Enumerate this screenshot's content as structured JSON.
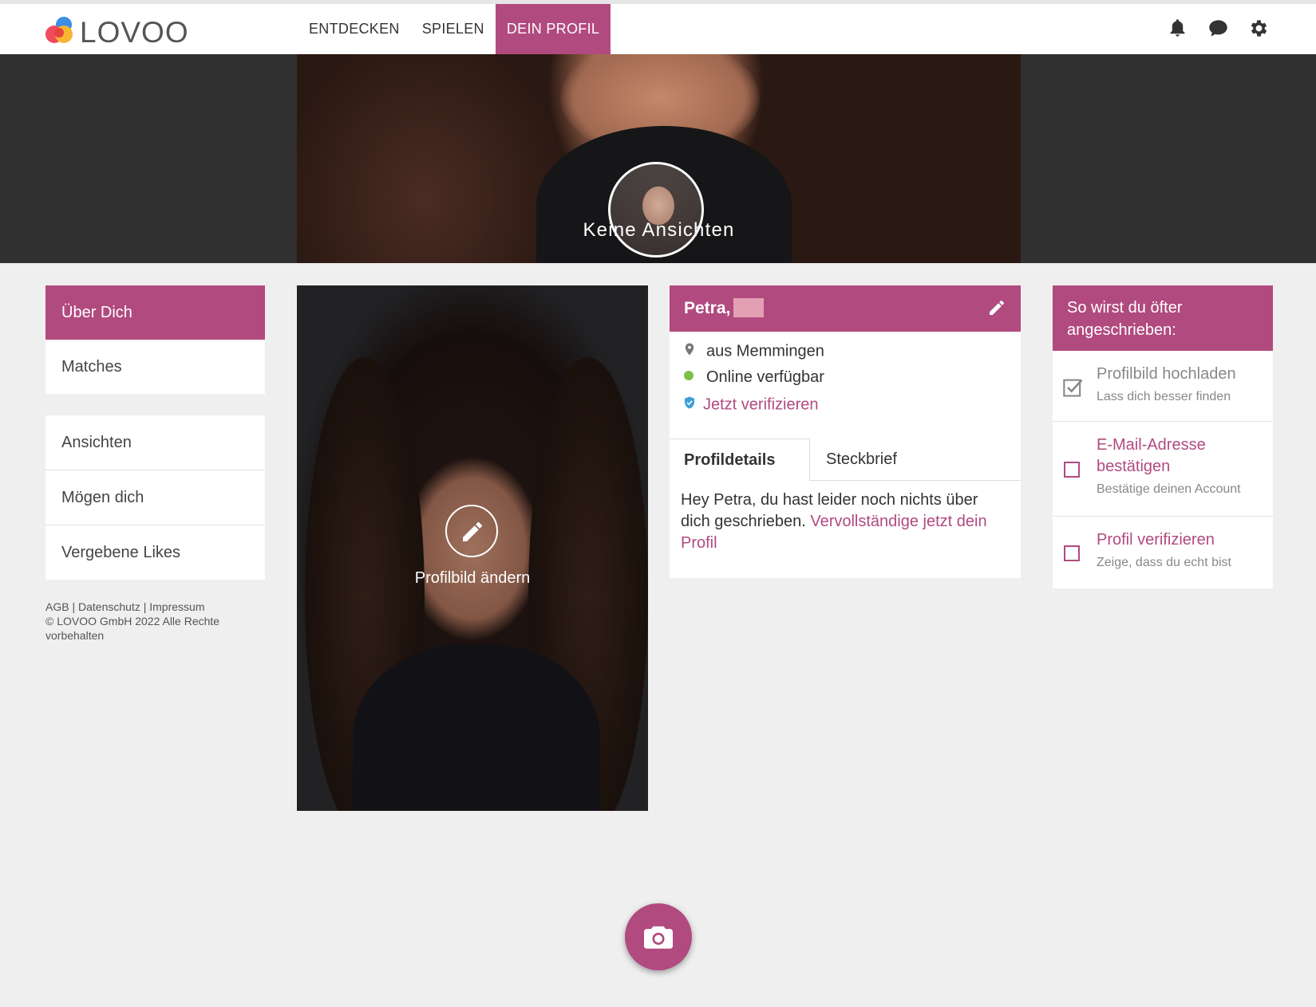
{
  "header": {
    "logo_text": "LOVOO",
    "nav": [
      {
        "label": "ENTDECKEN",
        "active": false
      },
      {
        "label": "SPIELEN",
        "active": false
      },
      {
        "label": "DEIN PROFIL",
        "active": true
      }
    ],
    "icons": [
      "bell-icon",
      "chat-bubble-icon",
      "gear-icon"
    ]
  },
  "banner": {
    "views_text": "Keine Ansichten"
  },
  "sidebar": {
    "groups": [
      [
        {
          "label": "Über Dich",
          "active": true
        },
        {
          "label": "Matches",
          "active": false
        }
      ],
      [
        {
          "label": "Ansichten",
          "active": false
        },
        {
          "label": "Mögen dich",
          "active": false
        },
        {
          "label": "Vergebene Likes",
          "active": false
        }
      ]
    ],
    "footer": {
      "links": [
        "AGB",
        "Datenschutz",
        "Impressum"
      ],
      "copyright": "© LOVOO GmbH 2022 Alle Rechte vorbehalten"
    }
  },
  "photo": {
    "change_label": "Profilbild ändern"
  },
  "profile": {
    "name": "Petra,",
    "location": "aus Memmingen",
    "status": "Online verfügbar",
    "verify_link": "Jetzt verifizieren",
    "tabs": [
      {
        "label": "Profildetails",
        "active": true
      },
      {
        "label": "Steckbrief",
        "active": false
      }
    ],
    "description": "Hey Petra, du hast leider noch nichts über dich geschrieben.",
    "complete_link": "Vervollständige jetzt dein Profil"
  },
  "tips": {
    "title": "So wirst du öfter angeschrieben:",
    "items": [
      {
        "title": "Profilbild hochladen",
        "sub": "Lass dich besser finden",
        "done": true
      },
      {
        "title": "E-Mail-Adresse bestätigen",
        "sub": "Bestätige deinen Account",
        "done": false
      },
      {
        "title": "Profil verifizieren",
        "sub": "Zeige, dass du echt bist",
        "done": false
      }
    ]
  },
  "colors": {
    "accent": "#b14a7f",
    "online": "#7dbf4b",
    "shield": "#3ea0d8",
    "background": "#efefef"
  }
}
